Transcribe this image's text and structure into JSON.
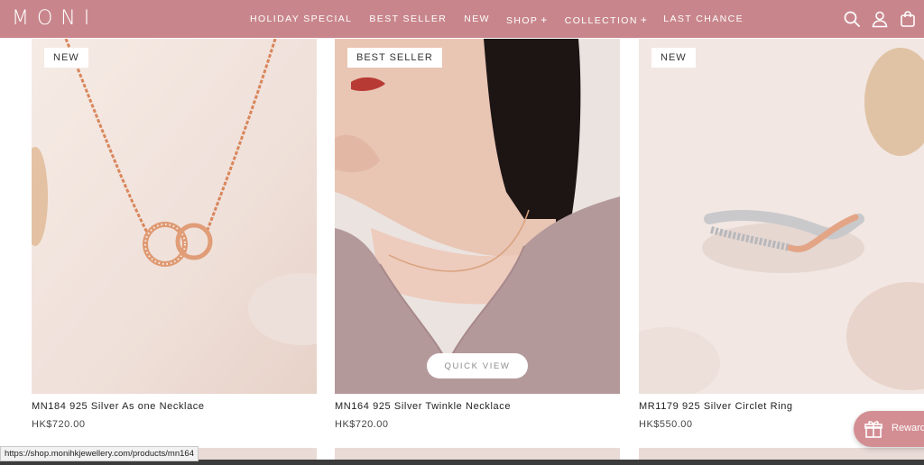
{
  "brand": {
    "logo_text": "MONI"
  },
  "nav": {
    "items": [
      {
        "label": "HOLIDAY SPECIAL"
      },
      {
        "label": "BEST SELLER"
      },
      {
        "label": "NEW"
      },
      {
        "label": "SHOP"
      },
      {
        "label": "COLLECTION"
      },
      {
        "label": "LAST CHANCE"
      }
    ],
    "expand_symbol": "+"
  },
  "header_icons": [
    "search-icon",
    "account-icon",
    "cart-bag-icon"
  ],
  "colors": {
    "header_bg": "#c8868c",
    "rewards_bg": "#d38e93"
  },
  "products": [
    {
      "badge": "NEW",
      "name": "MN184 925 Silver As one Necklace",
      "price": "HK$720.00"
    },
    {
      "badge": "BEST SELLER",
      "name": "MN164 925 Silver Twinkle Necklace",
      "price": "HK$720.00",
      "quick_view": "QUICK VIEW"
    },
    {
      "badge": "NEW",
      "name": "MR1179 925 Silver Circlet Ring",
      "price": "HK$550.00"
    }
  ],
  "rewards": {
    "label": "Rewards"
  },
  "status_url": "https://shop.monihkjewellery.com/products/mn164"
}
